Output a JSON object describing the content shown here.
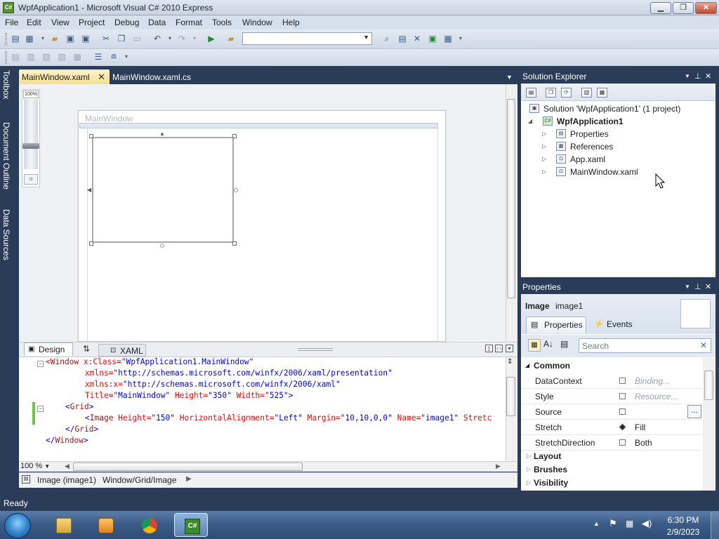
{
  "titlebar": {
    "title": "WpfApplication1 - Microsoft Visual C# 2010 Express",
    "icon": "C#"
  },
  "menu": [
    "File",
    "Edit",
    "View",
    "Project",
    "Debug",
    "Data",
    "Format",
    "Tools",
    "Window",
    "Help"
  ],
  "doc_tabs": {
    "active": "MainWindow.xaml",
    "inactive": "MainWindow.xaml.cs"
  },
  "designer": {
    "zoom_label": "100%",
    "window_title": "MainWindow"
  },
  "view_tabs": {
    "design": "Design",
    "xaml": "XAML"
  },
  "xaml": {
    "l1_tag": "<Window",
    "l1_a1": " x:Class=",
    "l1_v1": "\"WpfApplication1.MainWindow\"",
    "l2_a": "xmlns=",
    "l2_v": "\"http://schemas.microsoft.com/winfx/2006/xaml/presentation\"",
    "l3_a": "xmlns:x=",
    "l3_v": "\"http://schemas.microsoft.com/winfx/2006/xaml\"",
    "l4_a1": "Title=",
    "l4_v1": "\"MainWindow\"",
    "l4_a2": " Height=",
    "l4_v2": "\"350\"",
    "l4_a3": " Width=",
    "l4_v3": "\"525\"",
    "l4_end": ">",
    "l5_open": "<",
    "l5_tag": "Grid",
    "l5_end": ">",
    "l6_open": "<",
    "l6_tag": "Image",
    "l6_a1": " Height=",
    "l6_v1": "\"150\"",
    "l6_a2": " HorizontalAlignment=",
    "l6_v2": "\"Left\"",
    "l6_a3": " Margin=",
    "l6_v3": "\"10,10,0,0\"",
    "l6_a4": " Name=",
    "l6_v4": "\"image1\"",
    "l6_a5": " Stretc",
    "l7_open": "</",
    "l7_tag": "Grid",
    "l7_end": ">",
    "l8_open": "</",
    "l8_tag": "Window",
    "l8_end": ">"
  },
  "editor": {
    "zoom": "100 %"
  },
  "breadcrumb": {
    "selected": "Image (image1)",
    "path": "Window/Grid/Image"
  },
  "solution_explorer": {
    "title": "Solution Explorer",
    "solution": "Solution 'WpfApplication1' (1 project)",
    "project": "WpfApplication1",
    "items": [
      "Properties",
      "References",
      "App.xaml",
      "MainWindow.xaml"
    ]
  },
  "properties": {
    "title": "Properties",
    "type": "Image",
    "name": "image1",
    "tab_properties": "Properties",
    "tab_events": "Events",
    "search_placeholder": "Search",
    "category_common": "Common",
    "rows": [
      {
        "name": "DataContext",
        "value": "Binding..."
      },
      {
        "name": "Style",
        "value": "Resource..."
      },
      {
        "name": "Source",
        "value": ""
      },
      {
        "name": "Stretch",
        "value": "Fill"
      },
      {
        "name": "StretchDirection",
        "value": "Both"
      }
    ],
    "categories": [
      "Layout",
      "Brushes",
      "Visibility"
    ],
    "ellipsis": "..."
  },
  "toolbox_tabs": [
    "Toolbox",
    "Document Outline",
    "Data Sources"
  ],
  "status": {
    "text": "Ready"
  },
  "tray": {
    "time": "6:30 PM",
    "date": "2/9/2023"
  },
  "colors": {
    "chrome": "#2b3c59",
    "active_tab": "#f6df8e",
    "xaml_tag": "#a31515",
    "xaml_attr": "#ff0000",
    "xaml_value": "#0000ff"
  }
}
